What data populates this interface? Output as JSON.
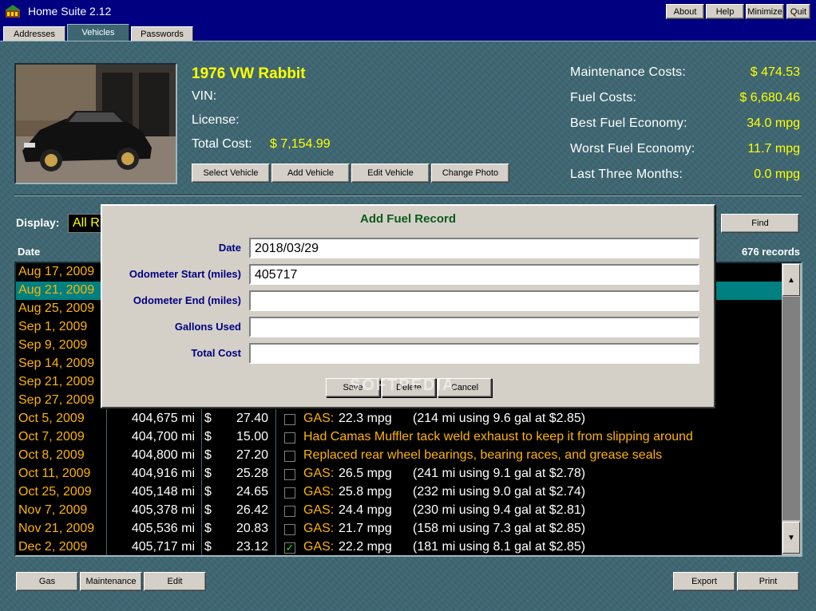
{
  "app": {
    "title": "Home Suite 2.12"
  },
  "topbar": {
    "about": "About",
    "help": "Help",
    "minimize": "Minimize",
    "quit": "Quit"
  },
  "tabs": [
    {
      "label": "Addresses"
    },
    {
      "label": "Vehicles"
    },
    {
      "label": "Passwords"
    }
  ],
  "vehicle": {
    "name": "1976 VW Rabbit",
    "vin_label": "VIN:",
    "license_label": "License:",
    "total_cost_label": "Total Cost:",
    "total_cost_value": "$ 7,154.99",
    "buttons": {
      "select": "Select Vehicle",
      "add": "Add Vehicle",
      "edit": "Edit Vehicle",
      "change_photo": "Change Photo"
    }
  },
  "stats": [
    {
      "label": "Maintenance Costs:",
      "value": "$ 474.53"
    },
    {
      "label": "Fuel Costs:",
      "value": "$ 6,680.46"
    },
    {
      "label": "Best Fuel Economy:",
      "value": "34.0 mpg"
    },
    {
      "label": "Worst Fuel Economy:",
      "value": "11.7 mpg"
    },
    {
      "label": "Last Three Months:",
      "value": "0.0 mpg"
    }
  ],
  "display": {
    "label": "Display:",
    "value": "All R"
  },
  "find_button": "Find",
  "list": {
    "date_header": "Date",
    "records": "676 records",
    "rows": [
      {
        "date": "Aug 17, 2009"
      },
      {
        "date": "Aug 21, 2009"
      },
      {
        "date": "Aug 25, 2009"
      },
      {
        "date": "Sep   1, 2009"
      },
      {
        "date": "Sep   9, 2009"
      },
      {
        "date": "Sep 14, 2009"
      },
      {
        "date": "Sep 21, 2009"
      },
      {
        "date": "Sep 27, 2009"
      },
      {
        "date": "Oct   5, 2009",
        "odo": "404,675 mi",
        "dollar": "$",
        "cost": "27.40",
        "gas": "GAS:",
        "mpg": "22.3 mpg",
        "detail": "(214 mi using 9.6 gal at $2.85)"
      },
      {
        "date": "Oct   7, 2009",
        "odo": "404,700 mi",
        "dollar": "$",
        "cost": "15.00",
        "note": "Had Camas Muffler tack weld exhaust to keep it from slipping around"
      },
      {
        "date": "Oct   8, 2009",
        "odo": "404,800 mi",
        "dollar": "$",
        "cost": "27.20",
        "note": "Replaced rear wheel bearings, bearing races, and grease seals"
      },
      {
        "date": "Oct 11, 2009",
        "odo": "404,916 mi",
        "dollar": "$",
        "cost": "25.28",
        "gas": "GAS:",
        "mpg": "26.5 mpg",
        "detail": "(241 mi using 9.1 gal at $2.78)"
      },
      {
        "date": "Oct 25, 2009",
        "odo": "405,148 mi",
        "dollar": "$",
        "cost": "24.65",
        "gas": "GAS:",
        "mpg": "25.8 mpg",
        "detail": "(232 mi using 9.0 gal at $2.74)"
      },
      {
        "date": "Nov   7, 2009",
        "odo": "405,378 mi",
        "dollar": "$",
        "cost": "26.42",
        "gas": "GAS:",
        "mpg": "24.4 mpg",
        "detail": "(230 mi using 9.4 gal at $2.81)"
      },
      {
        "date": "Nov 21, 2009",
        "odo": "405,536 mi",
        "dollar": "$",
        "cost": "20.83",
        "gas": "GAS:",
        "mpg": "21.7 mpg",
        "detail": "(158 mi using 7.3 gal at $2.85)"
      },
      {
        "date": "Dec   2, 2009",
        "odo": "405,717 mi",
        "dollar": "$",
        "cost": "23.12",
        "gas": "GAS:",
        "mpg": "22.2 mpg",
        "detail": "(181 mi using 8.1 gal at $2.85)",
        "check": "✓"
      }
    ]
  },
  "bottom": {
    "gas": "Gas",
    "maintenance": "Maintenance",
    "edit": "Edit",
    "export": "Export",
    "print": "Print"
  },
  "dialog": {
    "title": "Add Fuel Record",
    "fields": [
      {
        "label": "Date",
        "value": "2018/03/29"
      },
      {
        "label": "Odometer Start (miles)",
        "value": "405717"
      },
      {
        "label": "Odometer End (miles)",
        "value": ""
      },
      {
        "label": "Gallons Used",
        "value": ""
      },
      {
        "label": "Total Cost",
        "value": ""
      }
    ],
    "save": "Save",
    "delete": "Delete",
    "cancel": "Cancel",
    "watermark": "SOFTPEDIA"
  }
}
